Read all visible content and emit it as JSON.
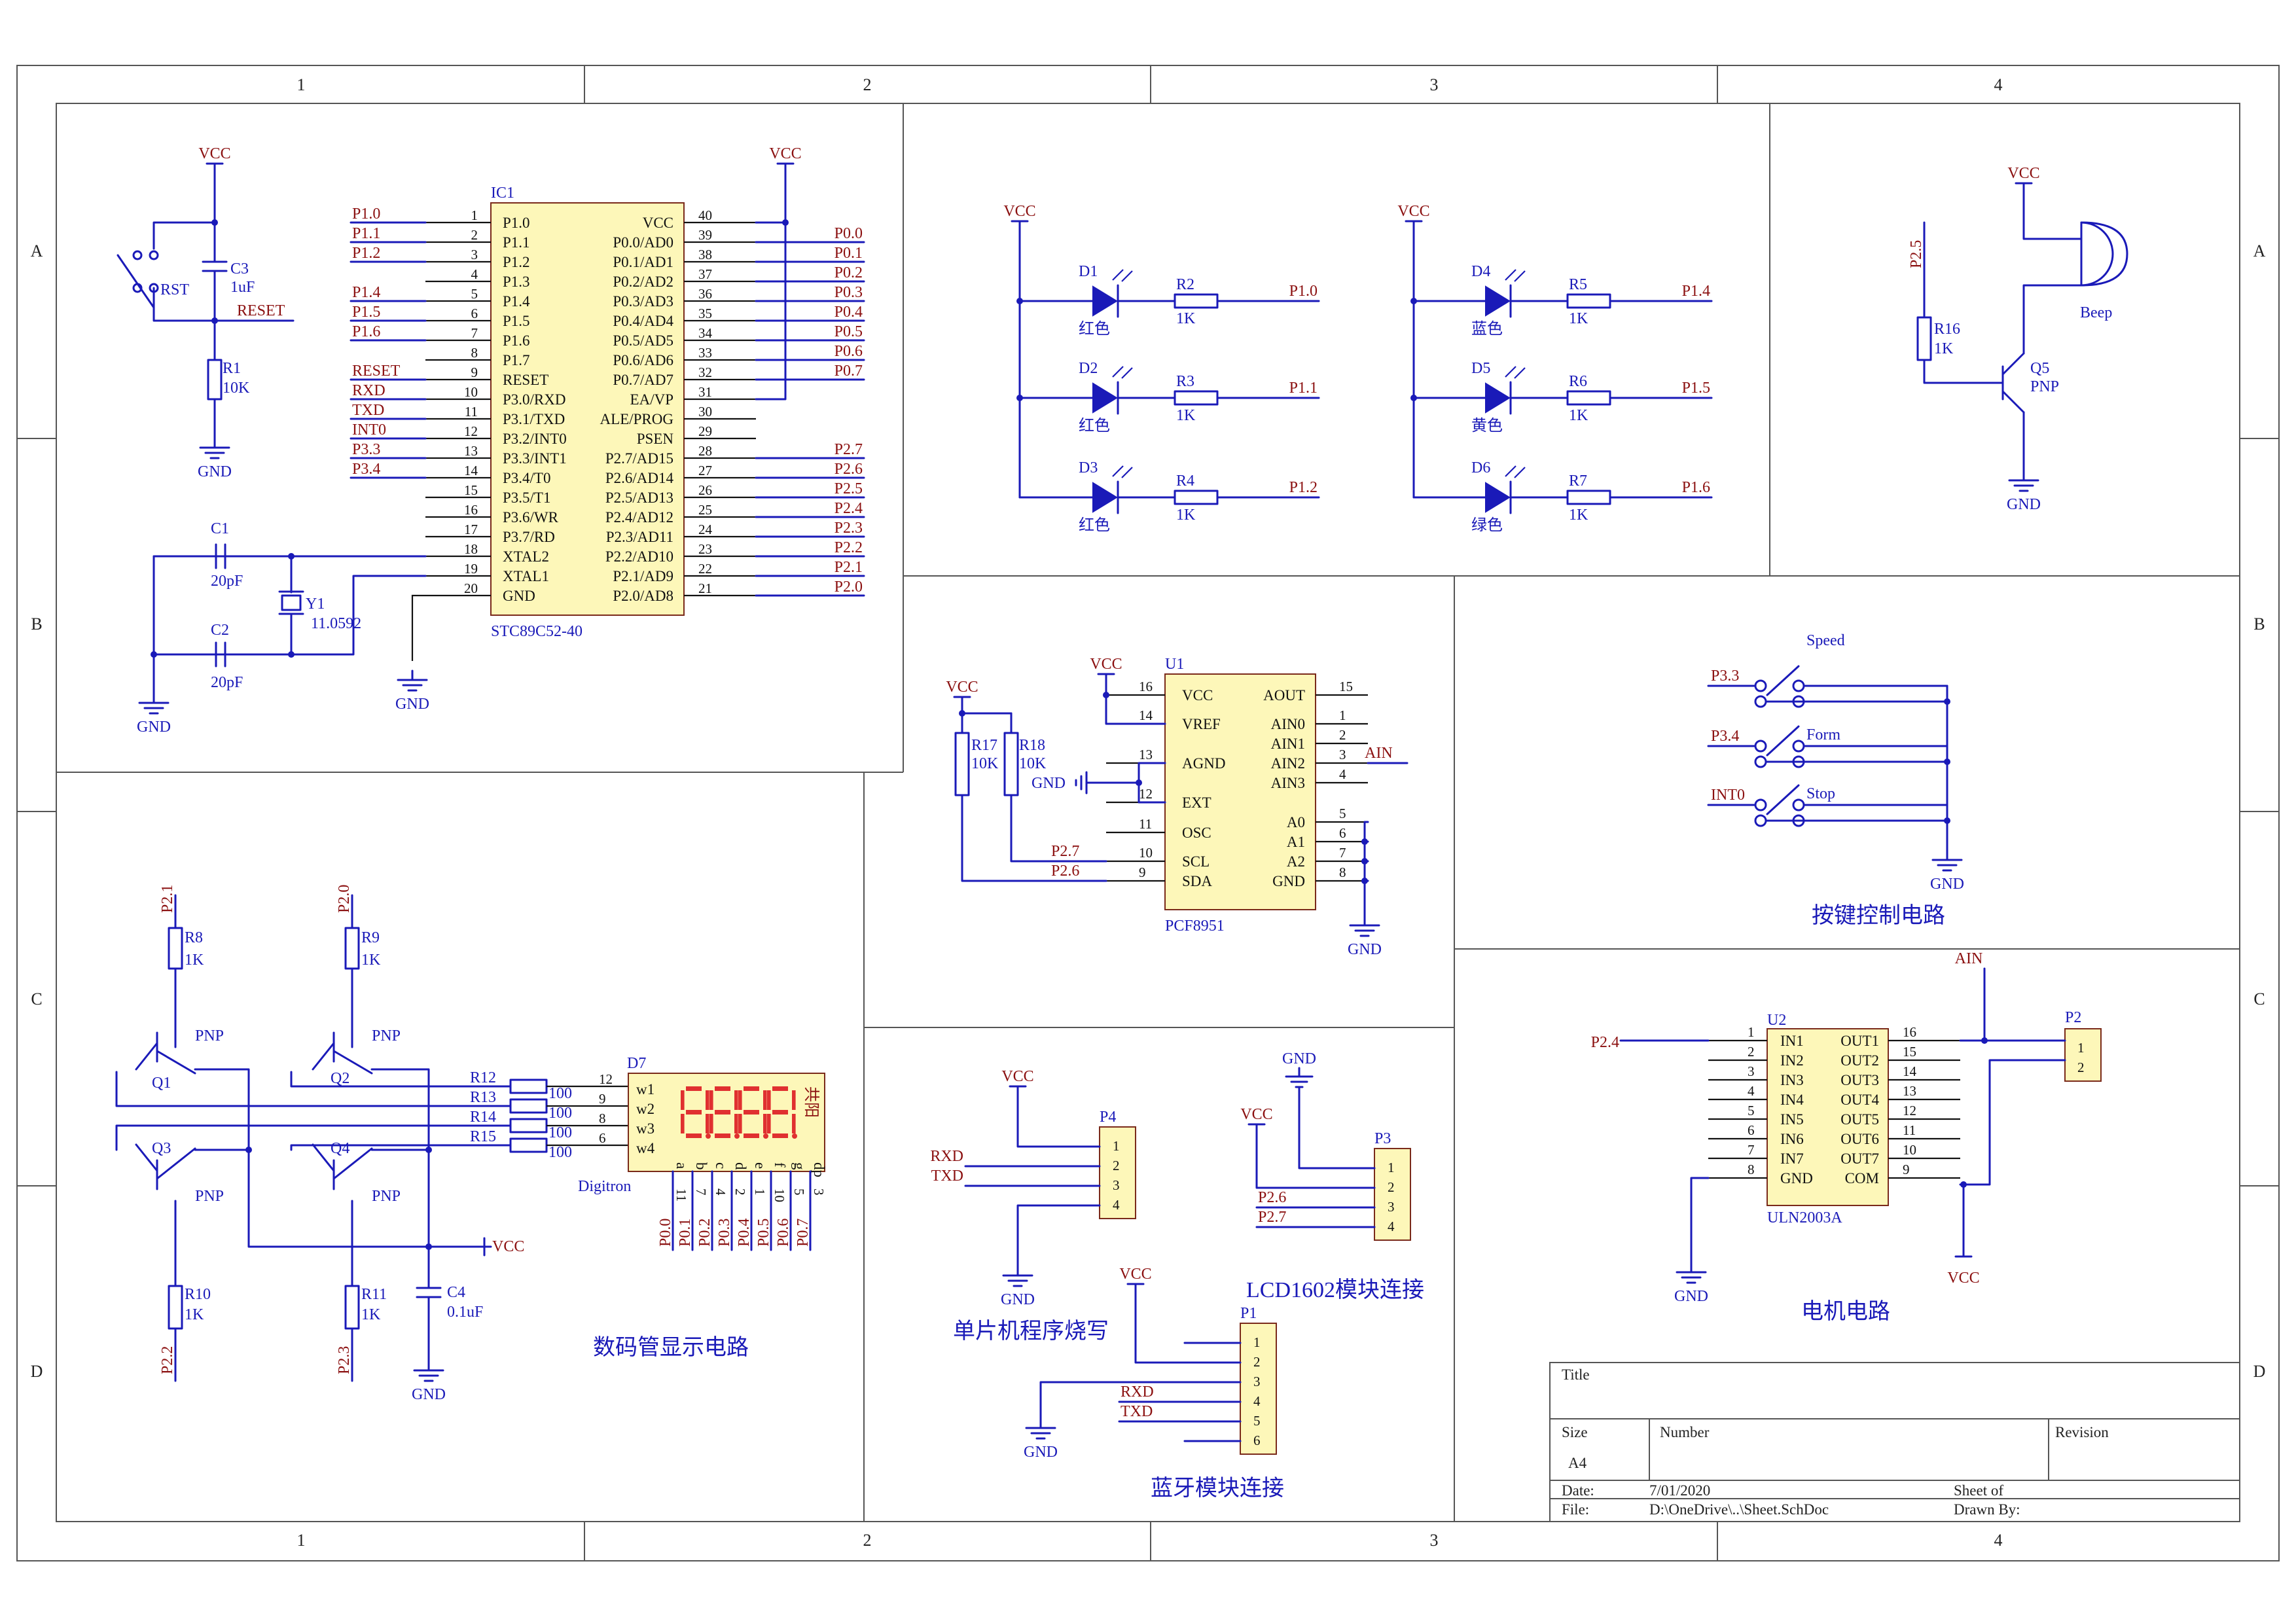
{
  "grid": {
    "cols": [
      "1",
      "2",
      "3",
      "4"
    ],
    "rows": [
      "A",
      "B",
      "C",
      "D"
    ]
  },
  "mcu": {
    "designator": "IC1",
    "part": "STC89C52-40",
    "left_pins": [
      {
        "num": "1",
        "name": "P1.0",
        "net": "P1.0"
      },
      {
        "num": "2",
        "name": "P1.1",
        "net": "P1.1"
      },
      {
        "num": "3",
        "name": "P1.2",
        "net": "P1.2"
      },
      {
        "num": "4",
        "name": "P1.3",
        "net": ""
      },
      {
        "num": "5",
        "name": "P1.4",
        "net": "P1.4"
      },
      {
        "num": "6",
        "name": "P1.5",
        "net": "P1.5"
      },
      {
        "num": "7",
        "name": "P1.6",
        "net": "P1.6"
      },
      {
        "num": "8",
        "name": "P1.7",
        "net": ""
      },
      {
        "num": "9",
        "name": "RESET",
        "net": "RESET"
      },
      {
        "num": "10",
        "name": "P3.0/RXD",
        "net": "RXD"
      },
      {
        "num": "11",
        "name": "P3.1/TXD",
        "net": "TXD"
      },
      {
        "num": "12",
        "name": "P3.2/INT0",
        "net": "INT0"
      },
      {
        "num": "13",
        "name": "P3.3/INT1",
        "net": "P3.3"
      },
      {
        "num": "14",
        "name": "P3.4/T0",
        "net": "P3.4"
      },
      {
        "num": "15",
        "name": "P3.5/T1",
        "net": ""
      },
      {
        "num": "16",
        "name": "P3.6/WR",
        "net": ""
      },
      {
        "num": "17",
        "name": "P3.7/RD",
        "net": ""
      },
      {
        "num": "18",
        "name": "XTAL2",
        "net": ""
      },
      {
        "num": "19",
        "name": "XTAL1",
        "net": ""
      },
      {
        "num": "20",
        "name": "GND",
        "net": ""
      }
    ],
    "right_pins": [
      {
        "num": "40",
        "name": "VCC",
        "net": ""
      },
      {
        "num": "39",
        "name": "P0.0/AD0",
        "net": "P0.0"
      },
      {
        "num": "38",
        "name": "P0.1/AD1",
        "net": "P0.1"
      },
      {
        "num": "37",
        "name": "P0.2/AD2",
        "net": "P0.2"
      },
      {
        "num": "36",
        "name": "P0.3/AD3",
        "net": "P0.3"
      },
      {
        "num": "35",
        "name": "P0.4/AD4",
        "net": "P0.4"
      },
      {
        "num": "34",
        "name": "P0.5/AD5",
        "net": "P0.5"
      },
      {
        "num": "33",
        "name": "P0.6/AD6",
        "net": "P0.6"
      },
      {
        "num": "32",
        "name": "P0.7/AD7",
        "net": "P0.7"
      },
      {
        "num": "31",
        "name": "EA/VP",
        "net": ""
      },
      {
        "num": "30",
        "name": "ALE/PROG",
        "net": ""
      },
      {
        "num": "29",
        "name": "PSEN",
        "net": ""
      },
      {
        "num": "28",
        "name": "P2.7/AD15",
        "net": "P2.7"
      },
      {
        "num": "27",
        "name": "P2.6/AD14",
        "net": "P2.6"
      },
      {
        "num": "26",
        "name": "P2.5/AD13",
        "net": "P2.5"
      },
      {
        "num": "25",
        "name": "P2.4/AD12",
        "net": "P2.4"
      },
      {
        "num": "24",
        "name": "P2.3/AD11",
        "net": "P2.3"
      },
      {
        "num": "23",
        "name": "P2.2/AD10",
        "net": "P2.2"
      },
      {
        "num": "22",
        "name": "P2.1/AD9",
        "net": "P2.1"
      },
      {
        "num": "21",
        "name": "P2.0/AD8",
        "net": "P2.0"
      }
    ]
  },
  "mcu_support": {
    "vcc": "VCC",
    "gnd": "GND",
    "rst_label": "RST",
    "c3": "C3",
    "c3_val": "1uF",
    "reset_net": "RESET",
    "r1": "R1",
    "r1_val": "10K",
    "c1": "C1",
    "c1_val": "20pF",
    "c2": "C2",
    "c2_val": "20pF",
    "y1": "Y1",
    "y1_val": "11.0592"
  },
  "leds": {
    "vcc": "VCC",
    "items": [
      {
        "d": "D1",
        "color": "红色",
        "r": "R2",
        "rv": "1K",
        "net": "P1.0"
      },
      {
        "d": "D2",
        "color": "红色",
        "r": "R3",
        "rv": "1K",
        "net": "P1.1"
      },
      {
        "d": "D3",
        "color": "红色",
        "r": "R4",
        "rv": "1K",
        "net": "P1.2"
      },
      {
        "d": "D4",
        "color": "蓝色",
        "r": "R5",
        "rv": "1K",
        "net": "P1.4"
      },
      {
        "d": "D5",
        "color": "黄色",
        "r": "R6",
        "rv": "1K",
        "net": "P1.5"
      },
      {
        "d": "D6",
        "color": "绿色",
        "r": "R7",
        "rv": "1K",
        "net": "P1.6"
      }
    ]
  },
  "beep": {
    "vcc": "VCC",
    "net": "P2.5",
    "r": "R16",
    "rv": "1K",
    "q": "Q5",
    "qtype": "PNP",
    "name": "Beep",
    "gnd": "GND"
  },
  "adc": {
    "designator": "U1",
    "part": "PCF8951",
    "vcc": "VCC",
    "gnd": "GND",
    "r17": "R17",
    "r17v": "10K",
    "r18": "R18",
    "r18v": "10K",
    "ain_net": "AIN",
    "left_pins": [
      {
        "num": "16",
        "name": "VCC"
      },
      {
        "num": "14",
        "name": "VREF"
      },
      {
        "num": "13",
        "name": "AGND"
      },
      {
        "num": "12",
        "name": "EXT"
      },
      {
        "num": "11",
        "name": "OSC"
      },
      {
        "num": "10",
        "name": "SCL",
        "net": "P2.7"
      },
      {
        "num": "9",
        "name": "SDA",
        "net": "P2.6"
      }
    ],
    "right_pins": [
      {
        "num": "15",
        "name": "AOUT"
      },
      {
        "num": "1",
        "name": "AIN0"
      },
      {
        "num": "2",
        "name": "AIN1"
      },
      {
        "num": "3",
        "name": "AIN2"
      },
      {
        "num": "4",
        "name": "AIN3"
      },
      {
        "num": "5",
        "name": "A0"
      },
      {
        "num": "6",
        "name": "A1"
      },
      {
        "num": "7",
        "name": "A2"
      },
      {
        "num": "8",
        "name": "GND"
      }
    ]
  },
  "keys": {
    "title": "按键控制电路",
    "gnd": "GND",
    "items": [
      {
        "net": "P3.3",
        "label": "Speed"
      },
      {
        "net": "P3.4",
        "label": "Form"
      },
      {
        "net": "INT0",
        "label": "Stop"
      }
    ]
  },
  "display": {
    "title": "数码管显示电路",
    "vcc": "VCC",
    "gnd": "GND",
    "c4": "C4",
    "c4v": "0.1uF",
    "d7": "D7",
    "dname": "Digitron",
    "common": "共阳",
    "pnp": "PNP",
    "top_res": [
      {
        "r": "R8",
        "rv": "1K",
        "net": "P2.1"
      },
      {
        "r": "R9",
        "rv": "1K",
        "net": "P2.0"
      }
    ],
    "bot_res": [
      {
        "r": "R10",
        "rv": "1K",
        "net": "P2.2"
      },
      {
        "r": "R11",
        "rv": "1K",
        "net": "P2.3"
      }
    ],
    "q": [
      "Q1",
      "Q2",
      "Q3",
      "Q4"
    ],
    "seg_res": [
      {
        "r": "R12",
        "rv": "100",
        "pin": "12",
        "w": "w1"
      },
      {
        "r": "R13",
        "rv": "100",
        "pin": "9",
        "w": "w2"
      },
      {
        "r": "R14",
        "rv": "100",
        "pin": "8",
        "w": "w3"
      },
      {
        "r": "R15",
        "rv": "100",
        "pin": "6",
        "w": "w4"
      }
    ],
    "digits": [
      "8",
      "8",
      "8",
      "8"
    ],
    "seg_names": [
      "a",
      "b",
      "c",
      "d",
      "e",
      "f",
      "g",
      "dp"
    ],
    "seg_pins": [
      "11",
      "7",
      "4",
      "2",
      "1",
      "10",
      "5",
      "3"
    ],
    "seg_nets": [
      "P0.0",
      "P0.1",
      "P0.2",
      "P0.3",
      "P0.4",
      "P0.5",
      "P0.6",
      "P0.7"
    ]
  },
  "prog": {
    "title": "单片机程序烧写",
    "p": "P4",
    "vcc": "VCC",
    "gnd": "GND",
    "nets": [
      "RXD",
      "TXD"
    ],
    "pins": [
      "1",
      "2",
      "3",
      "4"
    ]
  },
  "lcd": {
    "title": "LCD1602模块连接",
    "p": "P3",
    "vcc": "VCC",
    "gnd": "GND",
    "nets": [
      "P2.6",
      "P2.7"
    ],
    "pins": [
      "1",
      "2",
      "3",
      "4"
    ]
  },
  "bt": {
    "title": "蓝牙模块连接",
    "p": "P1",
    "vcc": "VCC",
    "gnd": "GND",
    "nets": [
      "RXD",
      "TXD"
    ],
    "pins": [
      "1",
      "2",
      "3",
      "4",
      "5",
      "6"
    ]
  },
  "motor": {
    "title": "电机电路",
    "u": "U2",
    "part": "ULN2003A",
    "ain": "AIN",
    "net_in": "P2.4",
    "p": "P2",
    "ppins": [
      "1",
      "2"
    ],
    "vcc": "VCC",
    "gnd": "GND",
    "left_pins": [
      {
        "num": "1",
        "name": "IN1"
      },
      {
        "num": "2",
        "name": "IN2"
      },
      {
        "num": "3",
        "name": "IN3"
      },
      {
        "num": "4",
        "name": "IN4"
      },
      {
        "num": "5",
        "name": "IN5"
      },
      {
        "num": "6",
        "name": "IN6"
      },
      {
        "num": "7",
        "name": "IN7"
      },
      {
        "num": "8",
        "name": "GND"
      }
    ],
    "right_pins": [
      {
        "num": "16",
        "name": "OUT1"
      },
      {
        "num": "15",
        "name": "OUT2"
      },
      {
        "num": "14",
        "name": "OUT3"
      },
      {
        "num": "13",
        "name": "OUT4"
      },
      {
        "num": "12",
        "name": "OUT5"
      },
      {
        "num": "11",
        "name": "OUT6"
      },
      {
        "num": "10",
        "name": "OUT7"
      },
      {
        "num": "9",
        "name": "COM"
      }
    ]
  },
  "title_block": {
    "title_label": "Title",
    "size_label": "Size",
    "size": "A4",
    "number_label": "Number",
    "revision_label": "Revision",
    "date_label": "Date:",
    "date": "7/01/2020",
    "sheet_label": "Sheet  of",
    "file_label": "File:",
    "file": "D:\\OneDrive\\..\\Sheet.SchDoc",
    "drawn_label": "Drawn By:"
  }
}
